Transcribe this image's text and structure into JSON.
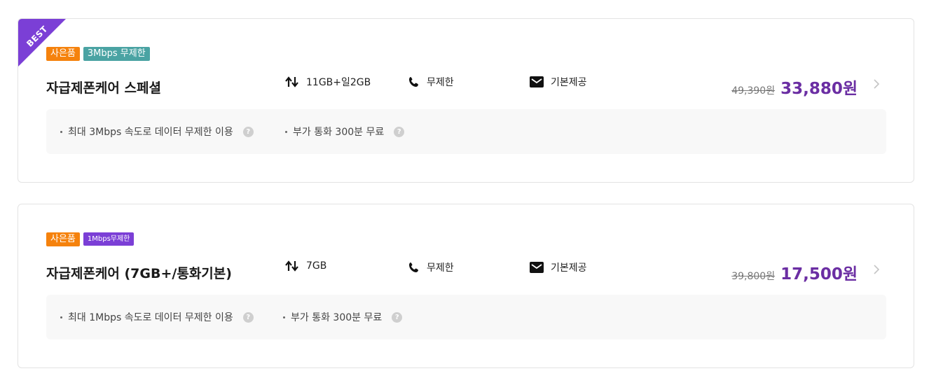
{
  "colors": {
    "gift_badge": "#f5820d",
    "speed_badge_1": "#4aa3a3",
    "speed_badge_2": "#7b3fd6",
    "ribbon": "#7b3fd6",
    "price": "#6b2ea3"
  },
  "plans": [
    {
      "ribbon": "BEST",
      "badges": [
        {
          "label": "사은품",
          "color": "#f5820d"
        },
        {
          "label": "3Mbps 무제한",
          "color": "#4aa3a3"
        }
      ],
      "name": "자급제폰케어 스페셜",
      "data": "11GB+일2GB",
      "call": "무제한",
      "sms": "기본제공",
      "old_price": "49,390원",
      "new_price": "33,880원",
      "benefits": [
        "최대 3Mbps 속도로 데이터 무제한 이용",
        "부가 통화 300분 무료"
      ]
    },
    {
      "badges": [
        {
          "label": "사은품",
          "color": "#f5820d"
        },
        {
          "label": "1Mbps무제한",
          "color": "#7b3fd6"
        }
      ],
      "name": "자급제폰케어 (7GB+/통화기본)",
      "data": "7GB",
      "call": "무제한",
      "sms": "기본제공",
      "old_price": "39,800원",
      "new_price": "17,500원",
      "benefits": [
        "최대 1Mbps 속도로 데이터 무제한 이용",
        "부가 통화 300분 무료"
      ]
    }
  ],
  "icons": {
    "data": "data-arrows-icon",
    "call": "phone-icon",
    "sms": "envelope-icon",
    "info": "question-circle-icon",
    "arrow": "chevron-right-icon"
  }
}
